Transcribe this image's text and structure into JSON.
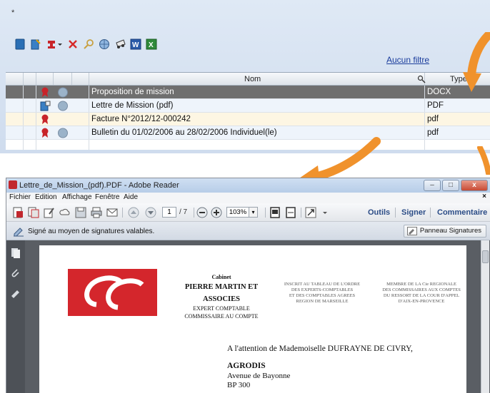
{
  "manager": {
    "window_marker": "*",
    "filter_link": "Aucun filtre",
    "columns": {
      "name": "Nom",
      "type": "Type"
    },
    "rows": [
      {
        "name": "Proposition de mission",
        "type": "DOCX",
        "selected": true
      },
      {
        "name": "Lettre de Mission (pdf)",
        "type": "PDF",
        "selected": false
      },
      {
        "name": "Facture N°2012/12-000242",
        "type": "pdf",
        "selected": false
      },
      {
        "name": "Bulletin du 01/02/2006 au 28/02/2006  Individuel(le)",
        "type": "pdf",
        "selected": false
      }
    ]
  },
  "reader": {
    "title": "Lettre_de_Mission_(pdf).PDF - Adobe Reader",
    "menu": [
      "Fichier",
      "Edition",
      "Affichage",
      "Fenêtre",
      "Aide"
    ],
    "menu_close": "×",
    "page_current": "1",
    "page_total": "/ 7",
    "zoom": "103%",
    "links": {
      "tools": "Outils",
      "sign": "Signer",
      "comment": "Commentaire"
    },
    "signature_status": "Signé au moyen de signatures valables.",
    "signature_panel": "Panneau Signatures"
  },
  "document": {
    "firm": {
      "cabinet": "Cabinet",
      "name_line1": "PIERRE MARTIN ET",
      "name_line2": "ASSOCIES",
      "role1": "EXPERT COMPTABLE",
      "role2": "COMMISSAIRE AU COMPTE"
    },
    "col2": [
      "INSCRIT AU TABLEAU DE L'ORDRE",
      "DES EXPERTS-COMPTABLES",
      "ET DES COMPTABLES AGREES",
      "REGION DE MARSEILLE"
    ],
    "col3": [
      "MEMBRE DE LA Cie REGIONALE",
      "DES COMMISSAIRES AUX COMPTES",
      "DU RESSORT DE LA COUR D'APPEL",
      "D'AIX-EN-PROVENCE"
    ],
    "attention": "A l'attention de Mademoiselle DUFRAYNE DE CIVRY,",
    "recipient": "AGRODIS",
    "address1": "Avenue de Bayonne",
    "address2": "BP 300"
  },
  "colors": {
    "accent_orange": "#f0922c",
    "selected_row": "#6f6f6f",
    "logo_red": "#d4262c",
    "link_blue": "#2b4c86"
  }
}
